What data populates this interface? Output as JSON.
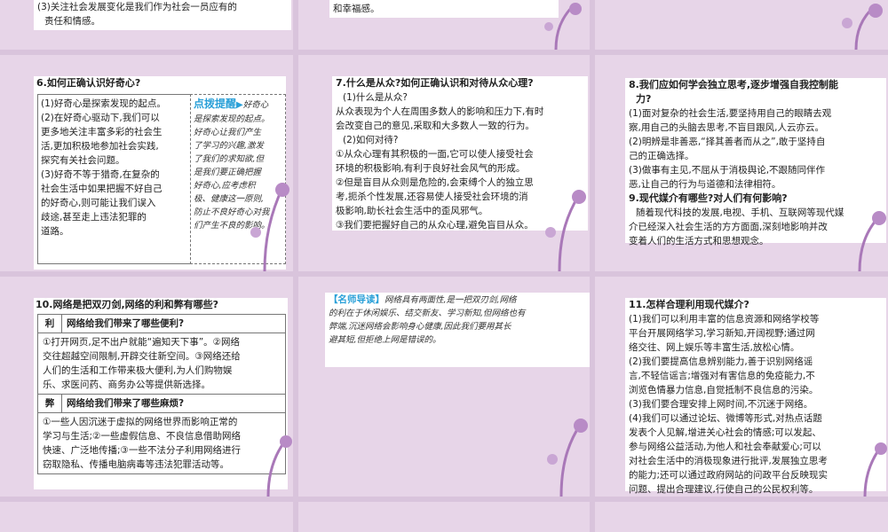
{
  "top_left": {
    "lines": [
      "(3)关注社会发展变化是我们作为社会一员应有的",
      "责任和情感。"
    ]
  },
  "top_mid": {
    "lines": [
      "和幸福感。"
    ]
  },
  "q6": {
    "title": "6.如何正确认识好奇心?",
    "body": [
      "(1)好奇心是探索发现的起点。",
      "(2)在好奇心驱动下,我们可以",
      "更多地关注丰富多彩的社会生",
      "活,更加积极地参加社会实践,",
      "探究有关社会问题。",
      "(3)好奇不等于猎奇,在复杂的",
      "社会生活中如果把握不好自己",
      "的好奇心,则可能让我们误入",
      "歧途,甚至走上违法犯罪的",
      "道路。"
    ],
    "tip_title": "点拨提醒",
    "tip_lines": [
      "好奇心",
      "是探索发现的起点。",
      "好奇心让我们产生",
      "了学习的兴趣,激发",
      "了我们的求知欲,但",
      "是我们要正确把握",
      "好奇心,应考虑积",
      "极、健康这一原则,",
      "防止不良好奇心对我",
      "们产生不良的影响。"
    ]
  },
  "q7": {
    "title": "7.什么是从众?如何正确认识和对待从众心理?",
    "lines": [
      "(1)什么是从众?",
      "从众表现为个人在周围多数人的影响和压力下,有时",
      "会改变自己的意见,采取和大多数人一致的行为。",
      "(2)如何对待?",
      "①从众心理有其积极的一面,它可以使人接受社会",
      "环境的积极影响,有利于良好社会风气的形成。",
      "②但是盲目从众则是危险的,会束缚个人的独立思",
      "考,扼杀个性发展,还容易使人接受社会环境的消",
      "极影响,助长社会生活中的歪风邪气。",
      "③我们要把握好自己的从众心理,避免盲目从众。"
    ]
  },
  "q8": {
    "title_lines": [
      "8.我们应如何学会独立思考,逐步增强自我控制能",
      "力?"
    ],
    "lines": [
      "(1)面对复杂的社会生活,要坚持用自己的眼睛去观",
      "察,用自己的头脑去思考,不盲目跟风,人云亦云。",
      "(2)明辨是非善恶,“择其善者而从之”,敢于坚持自",
      "己的正确选择。",
      "(3)做事有主见,不屈从于消极舆论,不跟随同伴作",
      "恶,让自己的行为与道德和法律相符。"
    ],
    "q9_title": "9.现代媒介有哪些?对人们有何影响?",
    "q9_lines": [
      "随着现代科技的发展,电视、手机、互联网等现代媒",
      "介已经深入社会生活的方方面面,深刻地影响并改",
      "变着人们的生活方式和思想观念。"
    ]
  },
  "q10": {
    "title": "10.网络是把双刃剑,网络的利和弊有哪些?",
    "pro_key": "利",
    "pro_head": "网络给我们带来了哪些便利?",
    "pro_lines": [
      "①打开网页,足不出户就能“遍知天下事”。②网络",
      "交往超越空间限制,开辟交往新空间。③网络还给",
      "人们的生活和工作带来极大便利,为人们购物娱",
      "乐、求医问药、商务办公等提供新选择。"
    ],
    "con_key": "弊",
    "con_head": "网络给我们带来了哪些麻烦?",
    "con_lines": [
      "①一些人因沉迷于虚拟的网络世界而影响正常的",
      "学习与生活;②一些虚假信息、不良信息借助网络",
      "快速、广泛地传播;③一些不法分子利用网络进行",
      "窃取隐私、传播电脑病毒等违法犯罪活动等。"
    ]
  },
  "guide": {
    "title": "【名师导读】",
    "lines": [
      "网络具有两面性,是一把双刃剑,网络",
      "的利在于休闲娱乐、结交新友、学习新知,但网络也有",
      "弊端,沉迷网络会影响身心健康,因此我们要用其长",
      "避其短,但拒绝上网是错误的。"
    ]
  },
  "q11": {
    "title": "11.怎样合理利用现代媒介?",
    "lines": [
      "(1)我们可以利用丰富的信息资源和网络学校等",
      "平台开展网络学习,学习新知,开阔视野;通过网",
      "络交往、网上娱乐等丰富生活,放松心情。",
      "(2)我们要提高信息辨别能力,善于识别网络谣",
      "言,不轻信谣言;增强对有害信息的免疫能力,不",
      "浏览色情暴力信息,自觉抵制不良信息的污染。",
      "(3)我们要合理安排上网时间,不沉迷于网络。",
      "(4)我们可以通过论坛、微博等形式,对热点话题",
      "发表个人见解,增进关心社会的情感;可以发起、",
      "参与网络公益活动,为他人和社会奉献爱心;可以",
      "对社会生活中的消极现象进行批评,发展独立思考",
      "的能力;还可以通过政府网站的问政平台反映现实",
      "问题、提出合理建议,行使自己的公民权利等。"
    ]
  },
  "colors": {
    "slide": "#e7d5e8",
    "gap": "#d9c4dc",
    "accent": "#2aa0d8",
    "deco": "#a978b8"
  }
}
